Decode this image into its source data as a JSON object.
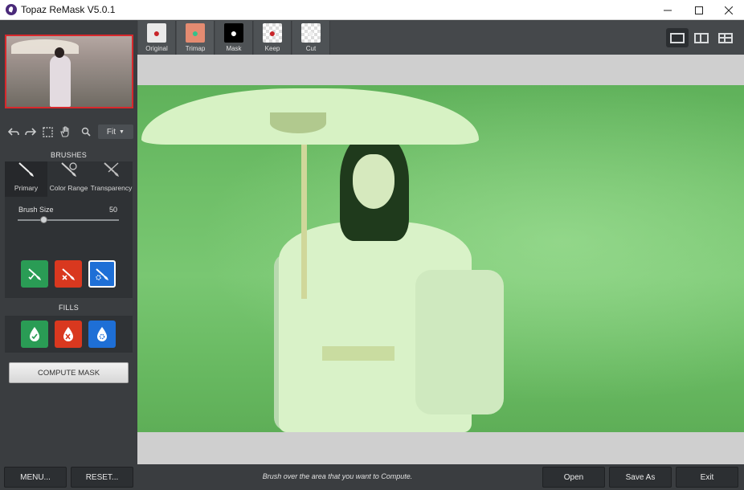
{
  "window": {
    "title": "Topaz ReMask V5.0.1",
    "minimize_icon": "minimize-icon",
    "maximize_icon": "maximize-icon",
    "close_icon": "close-icon"
  },
  "left_panel": {
    "zoom": {
      "selected": "Fit"
    },
    "brushes": {
      "heading": "BRUSHES",
      "tabs": [
        {
          "label": "Primary",
          "icon": "primary-brush-icon",
          "active": true
        },
        {
          "label": "Color Range",
          "icon": "color-range-brush-icon",
          "active": false
        },
        {
          "label": "Transparency",
          "icon": "transparency-brush-icon",
          "active": false
        }
      ],
      "brush_size_label": "Brush Size",
      "brush_size_value": "50",
      "brush_size_slider_fraction": 0.25,
      "buttons": [
        {
          "name": "keep-brush",
          "color": "#2a9c55",
          "icon": "keep-brush-icon"
        },
        {
          "name": "cut-brush",
          "color": "#d9381f",
          "icon": "cut-brush-icon"
        },
        {
          "name": "compute-brush",
          "color": "#1e6fd6",
          "icon": "compute-brush-icon",
          "selected": true
        }
      ]
    },
    "fills": {
      "heading": "FILLS",
      "buttons": [
        {
          "name": "keep-fill",
          "color": "#2a9c55",
          "icon": "keep-fill-icon"
        },
        {
          "name": "cut-fill",
          "color": "#d9381f",
          "icon": "cut-fill-icon"
        },
        {
          "name": "compute-fill",
          "color": "#1e6fd6",
          "icon": "compute-fill-icon"
        }
      ]
    },
    "compute_mask_label": "COMPUTE MASK"
  },
  "view_tabs": [
    {
      "label": "Original",
      "active": false
    },
    {
      "label": "Trimap",
      "active": true
    },
    {
      "label": "Mask",
      "active": false
    },
    {
      "label": "Keep",
      "active": false
    },
    {
      "label": "Cut",
      "active": false
    }
  ],
  "status_bar": {
    "menu_label": "MENU...",
    "reset_label": "RESET...",
    "message": "Brush over the area that you want to Compute.",
    "open_label": "Open",
    "save_as_label": "Save As",
    "exit_label": "Exit"
  },
  "colors": {
    "keep": "#2a9c55",
    "cut": "#d9381f",
    "compute": "#1e6fd6",
    "selection_border": "#d8282c"
  }
}
